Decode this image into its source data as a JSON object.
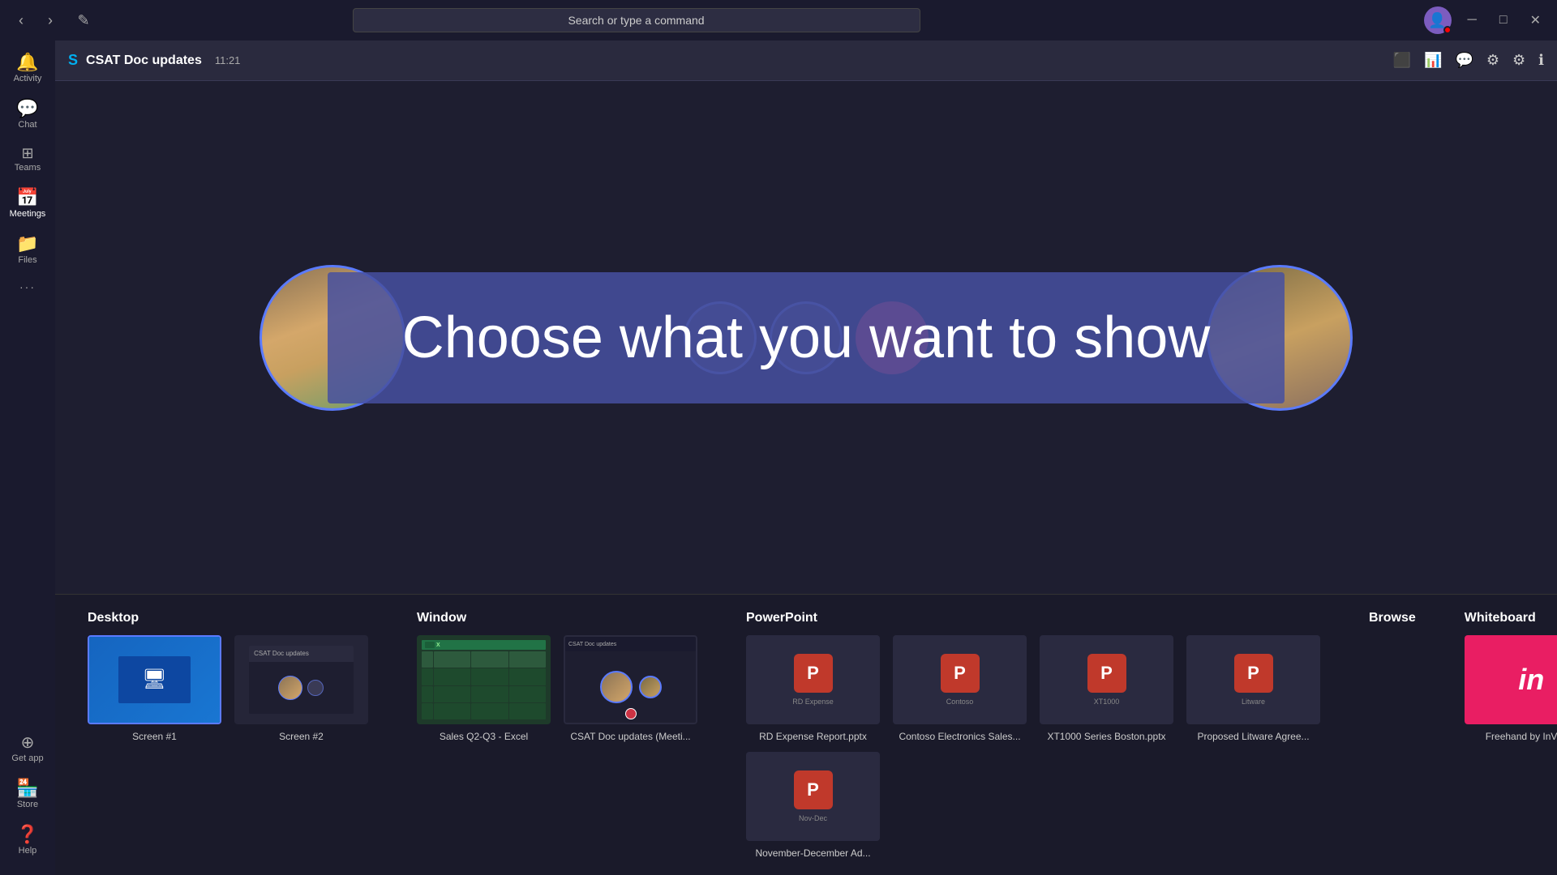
{
  "titlebar": {
    "search_placeholder": "Search or type a command",
    "back_icon": "‹",
    "forward_icon": "›",
    "compose_icon": "✎",
    "minimize_icon": "─",
    "maximize_icon": "□",
    "close_icon": "✕"
  },
  "sidebar": {
    "items": [
      {
        "id": "activity",
        "label": "Activity",
        "icon": "🔔",
        "active": false
      },
      {
        "id": "chat",
        "label": "Chat",
        "icon": "💬",
        "active": false
      },
      {
        "id": "teams",
        "label": "Teams",
        "icon": "⊞",
        "active": false
      },
      {
        "id": "meetings",
        "label": "Meetings",
        "icon": "📅",
        "active": true
      },
      {
        "id": "files",
        "label": "Files",
        "icon": "📁",
        "active": false
      }
    ],
    "bottom_items": [
      {
        "id": "get-app",
        "label": "Get app",
        "icon": "⊕"
      },
      {
        "id": "store",
        "label": "Store",
        "icon": "🏪"
      },
      {
        "id": "help",
        "label": "Help",
        "icon": "❓"
      }
    ],
    "more_icon": "···"
  },
  "meeting_header": {
    "title": "CSAT Doc updates",
    "time": "11:21",
    "skype_icon": "S",
    "actions": [
      {
        "id": "share-screen",
        "icon": "⬜"
      },
      {
        "id": "participants",
        "icon": "📊"
      },
      {
        "id": "chat",
        "icon": "💬"
      },
      {
        "id": "more",
        "icon": "⚙"
      },
      {
        "id": "settings",
        "icon": "⚙"
      },
      {
        "id": "info",
        "icon": "ℹ"
      }
    ]
  },
  "overlay": {
    "text": "Choose what you want to show"
  },
  "share_panel": {
    "categories": [
      {
        "id": "desktop",
        "label": "Desktop",
        "items": [
          {
            "id": "screen1",
            "label": "Screen #1",
            "type": "desktop1"
          },
          {
            "id": "screen2",
            "label": "Screen #2",
            "type": "desktop2"
          }
        ]
      },
      {
        "id": "window",
        "label": "Window",
        "items": [
          {
            "id": "excel",
            "label": "Sales Q2-Q3 - Excel",
            "type": "excel"
          },
          {
            "id": "teams-meeting",
            "label": "CSAT Doc updates (Meeti...",
            "type": "teams-window"
          }
        ]
      },
      {
        "id": "powerpoint",
        "label": "PowerPoint",
        "items": [
          {
            "id": "rd-expense",
            "label": "RD Expense Report.pptx",
            "type": "ppt-red"
          },
          {
            "id": "contoso",
            "label": "Contoso Electronics Sales...",
            "type": "ppt-red"
          },
          {
            "id": "xt1000",
            "label": "XT1000 Series Boston.pptx",
            "type": "ppt-red"
          },
          {
            "id": "litware",
            "label": "Proposed Litware Agree...",
            "type": "ppt-red"
          }
        ]
      }
    ],
    "browse_label": "Browse",
    "whiteboard": {
      "label": "Whiteboard",
      "items": [
        {
          "id": "invision",
          "label": "Freehand by InVision",
          "type": "invision"
        }
      ]
    },
    "ppt_row2": [
      {
        "id": "nov-dec",
        "label": "November-December Ad...",
        "type": "ppt-red"
      }
    ]
  }
}
